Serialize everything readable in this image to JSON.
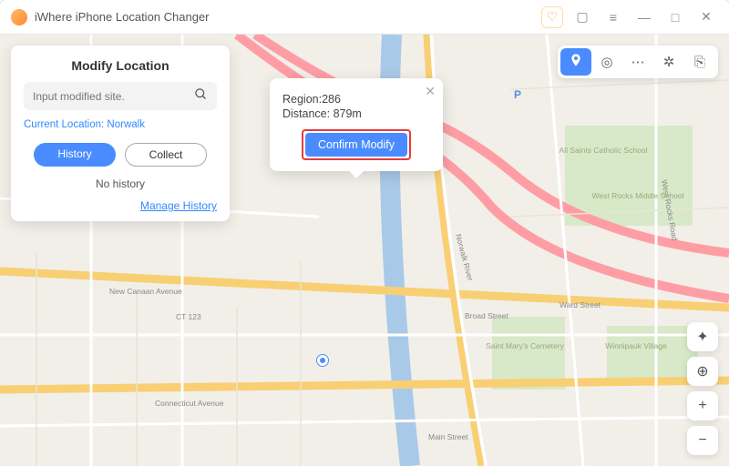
{
  "window": {
    "title": "iWhere iPhone Location Changer"
  },
  "sidebar": {
    "heading": "Modify Location",
    "search_placeholder": "Input modified site.",
    "current_location_label": "Current Location: Norwalk",
    "tab_history": "History",
    "tab_collect": "Collect",
    "empty_text": "No history",
    "manage_link": "Manage History"
  },
  "popup": {
    "region_label": "Region:286",
    "distance_label": "Distance: 879m",
    "confirm_label": "Confirm Modify"
  },
  "icons": {
    "heart": "♡",
    "menu": "≡",
    "min": "—",
    "max": "□",
    "close": "✕",
    "mag": "🔍",
    "pin": "📍",
    "walk": "◎",
    "route": "⋯",
    "joy": "✲",
    "exit": "⎘",
    "locate": "✦",
    "crosshair": "⊕",
    "plus": "+",
    "minus": "−",
    "window": "▢"
  },
  "map": {
    "roads": [
      "New Canaan Avenue",
      "Connecticut Avenue",
      "Norwalk River",
      "Broad Street",
      "Ward Street",
      "Main Street",
      "West Rocks Road",
      "CT 123"
    ],
    "places": [
      "All Saints Catholic School",
      "West Rocks Middle School",
      "Saint Mary's Cemetery",
      "Winnipauk Village"
    ]
  }
}
